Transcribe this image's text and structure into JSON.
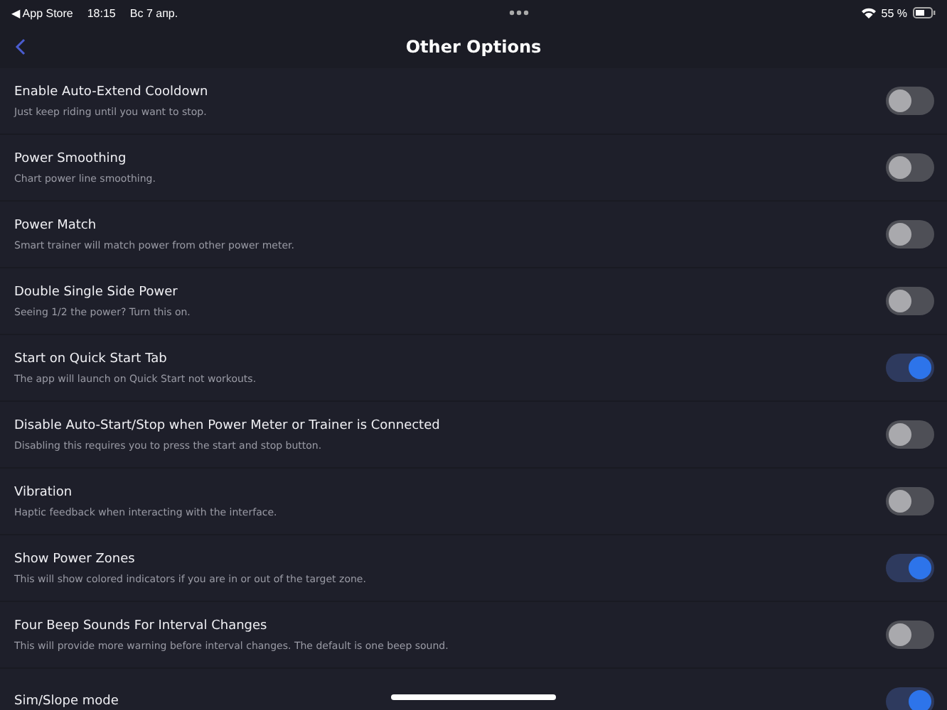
{
  "status_bar": {
    "back_app": "◀ App Store",
    "time": "18:15",
    "date": "Вс 7 апр.",
    "battery": "55 %"
  },
  "nav": {
    "title": "Other Options"
  },
  "options": [
    {
      "title": "Enable Auto-Extend Cooldown",
      "subtitle": "Just keep riding until you want to stop.",
      "on": false
    },
    {
      "title": "Power Smoothing",
      "subtitle": "Chart power line smoothing.",
      "on": false
    },
    {
      "title": "Power Match",
      "subtitle": "Smart trainer will match power from other power meter.",
      "on": false
    },
    {
      "title": "Double Single Side Power",
      "subtitle": "Seeing 1/2 the power? Turn this on.",
      "on": false
    },
    {
      "title": "Start on Quick Start Tab",
      "subtitle": "The app will launch on Quick Start not workouts.",
      "on": true
    },
    {
      "title": "Disable Auto-Start/Stop when Power Meter or Trainer is Connected",
      "subtitle": "Disabling this requires you to press the start and stop button.",
      "on": false
    },
    {
      "title": "Vibration",
      "subtitle": "Haptic feedback when interacting with the interface.",
      "on": false
    },
    {
      "title": "Show Power Zones",
      "subtitle": "This will show colored indicators if you are in or out of the target zone.",
      "on": true
    },
    {
      "title": "Four Beep Sounds For Interval Changes",
      "subtitle": "This will provide more warning before interval changes. The default is one beep sound.",
      "on": false
    },
    {
      "title": "Sim/Slope mode",
      "on": true
    }
  ]
}
